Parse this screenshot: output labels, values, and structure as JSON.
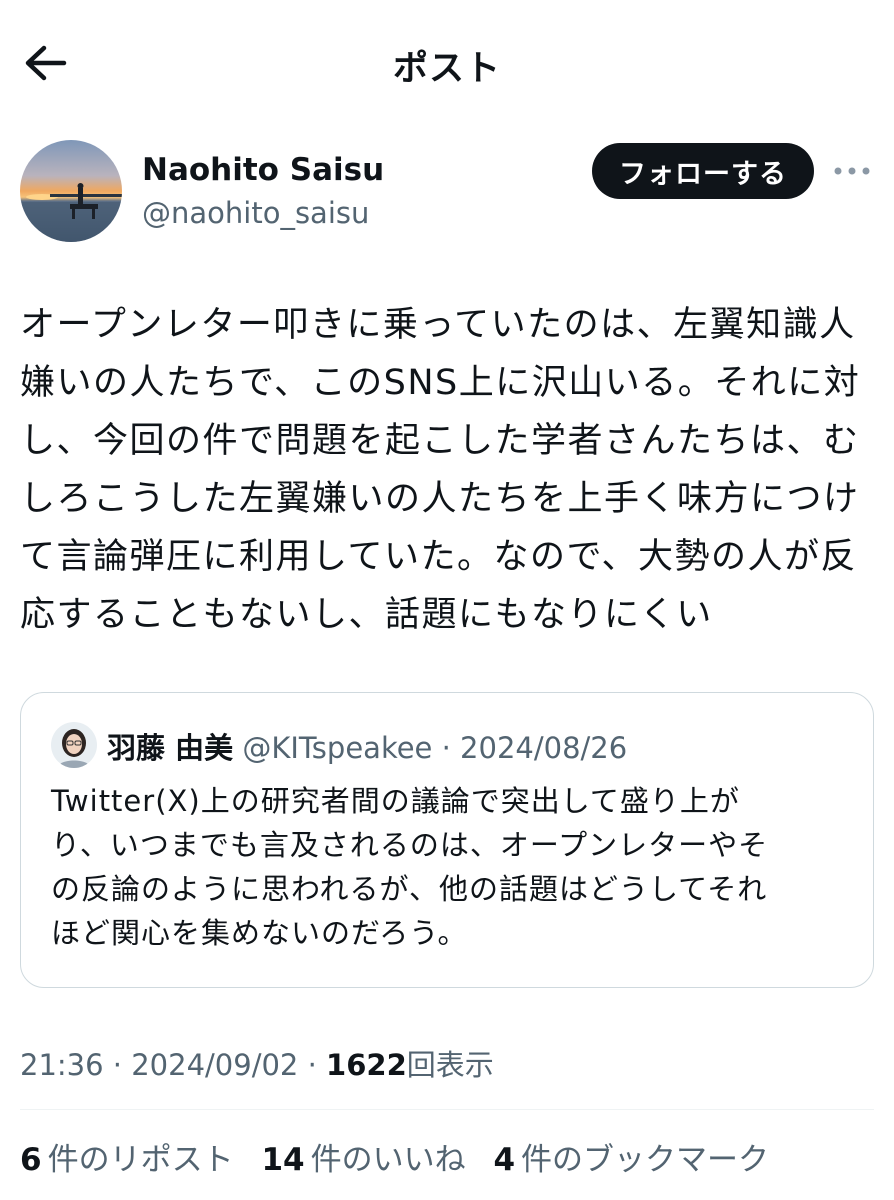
{
  "header": {
    "title": "ポスト",
    "back_icon": "arrow-left-icon"
  },
  "author": {
    "name": "Naohito Saisu",
    "handle": "@naohito_saisu",
    "follow_label": "フォローする",
    "more_icon": "ellipsis-icon"
  },
  "post": {
    "text": "オープンレター叩きに乗っていたのは、左翼知識人\n嫌いの人たちで、このSNS上に沢山いる。それに対\nし、今回の件で問題を起こした学者さんたちは、む\nしろこうした左翼嫌いの人たちを上手く味方につけ\nて言論弾圧に利用していた。なので、大勢の人が反\n応することもないし、話題にもなりにくい"
  },
  "quote": {
    "name": "羽藤 由美",
    "handle": "@KITspeakee",
    "separator": "·",
    "date": "2024/08/26",
    "text": "Twitter(X)上の研究者間の議論で突出して盛り上が\nり、いつまでも言及されるのは、オープンレターやそ\nの反論のように思われるが、他の話題はどうしてそれ\nほど関心を集めないのだろう。"
  },
  "meta": {
    "time": "21:36",
    "separator": "·",
    "date": "2024/09/02",
    "views_count": "1622",
    "views_label": "回表示"
  },
  "stats": {
    "reposts_count": "6",
    "reposts_label": "件のリポスト",
    "likes_count": "14",
    "likes_label": "件のいいね",
    "bookmarks_count": "4",
    "bookmarks_label": "件のブックマーク"
  },
  "colors": {
    "text": "#0f1419",
    "secondary": "#536471",
    "border": "#cfd9de",
    "follow_bg": "#0f1419"
  }
}
